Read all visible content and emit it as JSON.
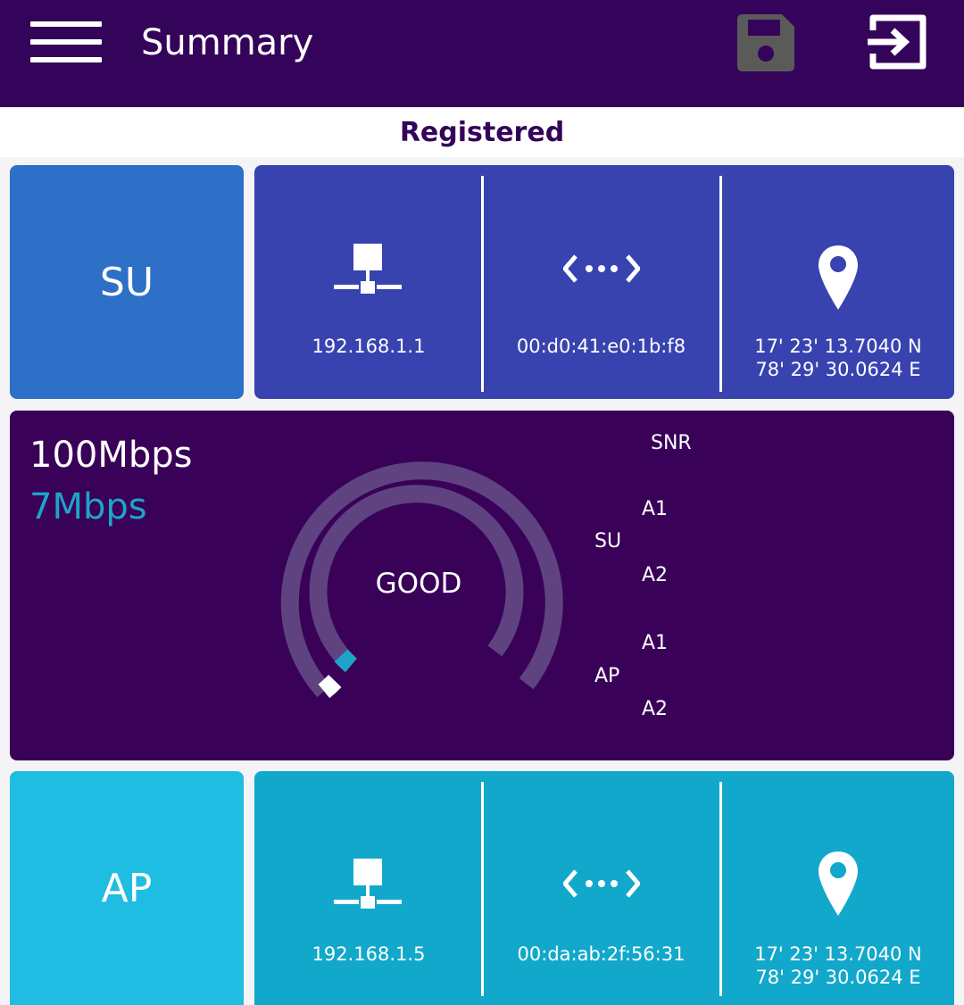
{
  "header": {
    "title": "Summary",
    "menu_icon": "hamburger-menu-icon",
    "save_icon": "save-icon",
    "logout_icon": "logout-icon",
    "colors": {
      "background": "#34035a",
      "save_disabled": "#5a5a5a"
    }
  },
  "status": {
    "text": "Registered"
  },
  "su": {
    "label": "SU",
    "ip": "192.168.1.1",
    "mac": "00:d0:41:e0:1b:f8",
    "lat": "17' 23' 13.7040 N",
    "lon": "78' 29' 30.0624 E",
    "colors": {
      "label_tile": "#2e6fc8",
      "info_tile": "#3843b0"
    }
  },
  "link": {
    "speed_max": "100Mbps",
    "speed_current": "7Mbps",
    "quality": "GOOD",
    "snr_title": "SNR",
    "su_label": "SU",
    "ap_label": "AP",
    "a1": "A1",
    "a2": "A2",
    "colors": {
      "panel": "#390157",
      "current_speed": "#1ea4c8"
    }
  },
  "ap": {
    "label": "AP",
    "ip": "192.168.1.5",
    "mac": "00:da:ab:2f:56:31",
    "lat": "17' 23' 13.7040 N",
    "lon": "78' 29' 30.0624 E",
    "colors": {
      "label_tile": "#1fbde1",
      "info_tile": "#12a8cb"
    }
  },
  "icons": {
    "network": "network-icon",
    "mac": "code-dots-icon",
    "location": "location-pin-icon"
  }
}
